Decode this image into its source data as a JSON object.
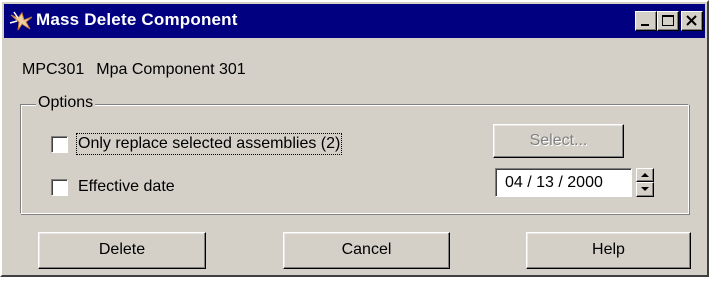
{
  "window": {
    "title": "Mass Delete Component",
    "controls": [
      "minimize-icon",
      "maximize-icon",
      "close-icon"
    ]
  },
  "component": {
    "code": "MPC301",
    "name": "Mpa Component 301"
  },
  "options": {
    "group_label": "Options",
    "replace_selected": {
      "label": "Only replace selected assemblies (2)",
      "checked": false
    },
    "effective_date": {
      "label": "Effective date",
      "checked": false
    },
    "select_button": "Select...",
    "date_value": "04 / 13 / 2000"
  },
  "buttons": {
    "delete": "Delete",
    "cancel": "Cancel",
    "help": "Help"
  },
  "colors": {
    "titlebar": "#000080",
    "face": "#d4d0c8"
  }
}
